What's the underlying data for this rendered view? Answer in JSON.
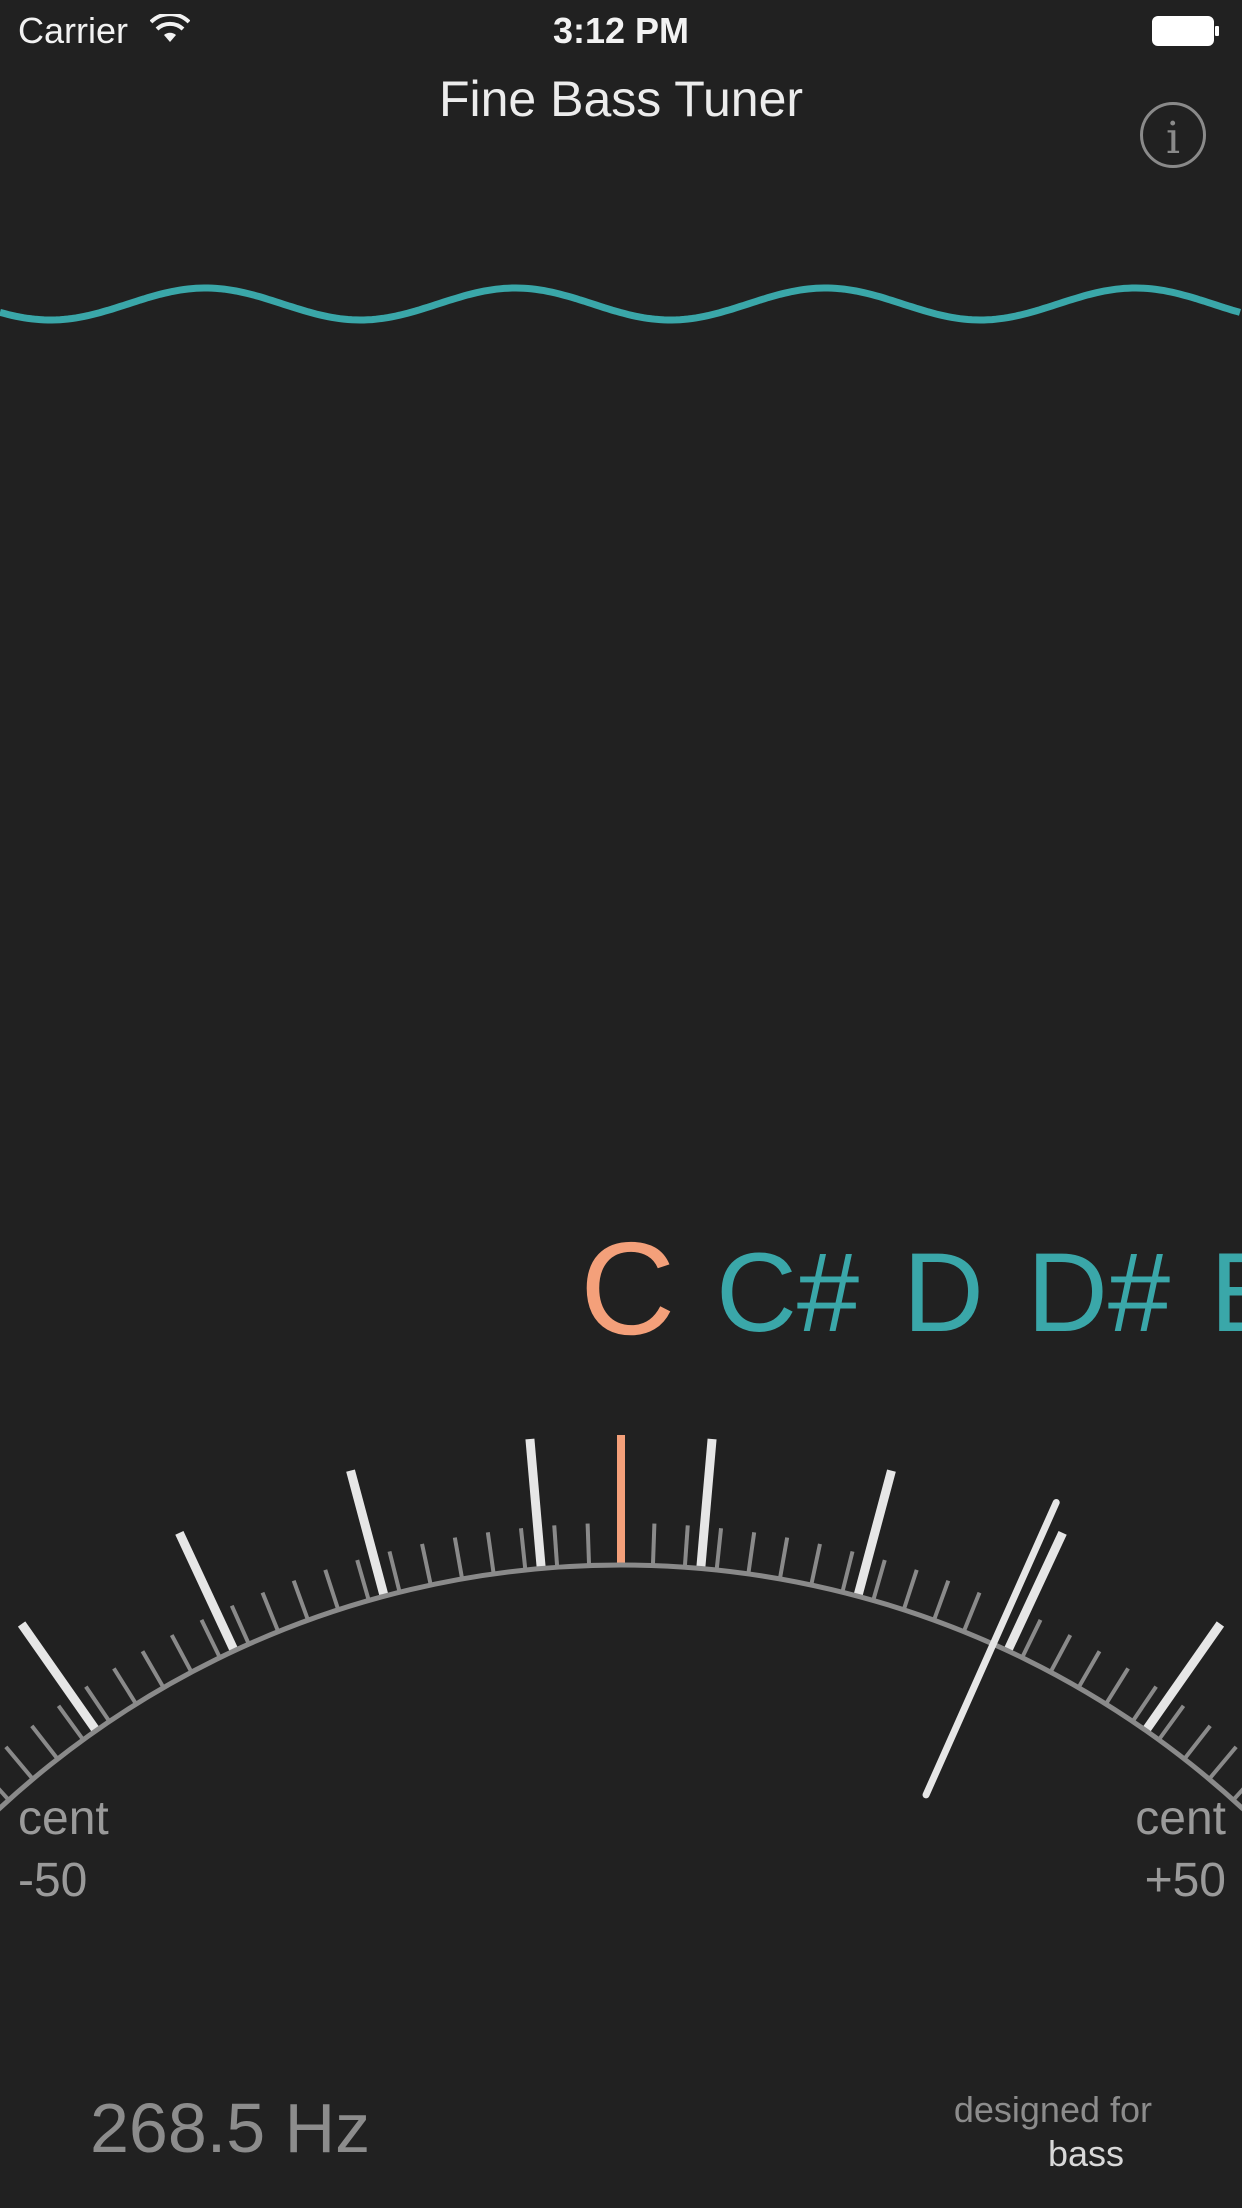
{
  "status_bar": {
    "carrier": "Carrier",
    "time": "3:12 PM"
  },
  "header": {
    "title": "Fine Bass Tuner",
    "info_icon": "info-icon",
    "info_glyph": "i"
  },
  "note_strip": {
    "active_note": "C",
    "other_notes": [
      "C#",
      "D",
      "D#",
      "E"
    ]
  },
  "meter": {
    "cent_min_label": "cent",
    "cent_min_value": "-50",
    "cent_max_label": "cent",
    "cent_max_value": "+50",
    "needle_cents": 24,
    "center_color": "#f4a07a",
    "tick_color": "#e6e6e6",
    "minor_tick_color": "#8a8a8a"
  },
  "readout": {
    "frequency": "268.5 Hz"
  },
  "footer": {
    "designed_for": "designed for",
    "instrument": "bass"
  },
  "colors": {
    "background": "#212121",
    "accent": "#3aa7a9",
    "active": "#f4a07a"
  }
}
